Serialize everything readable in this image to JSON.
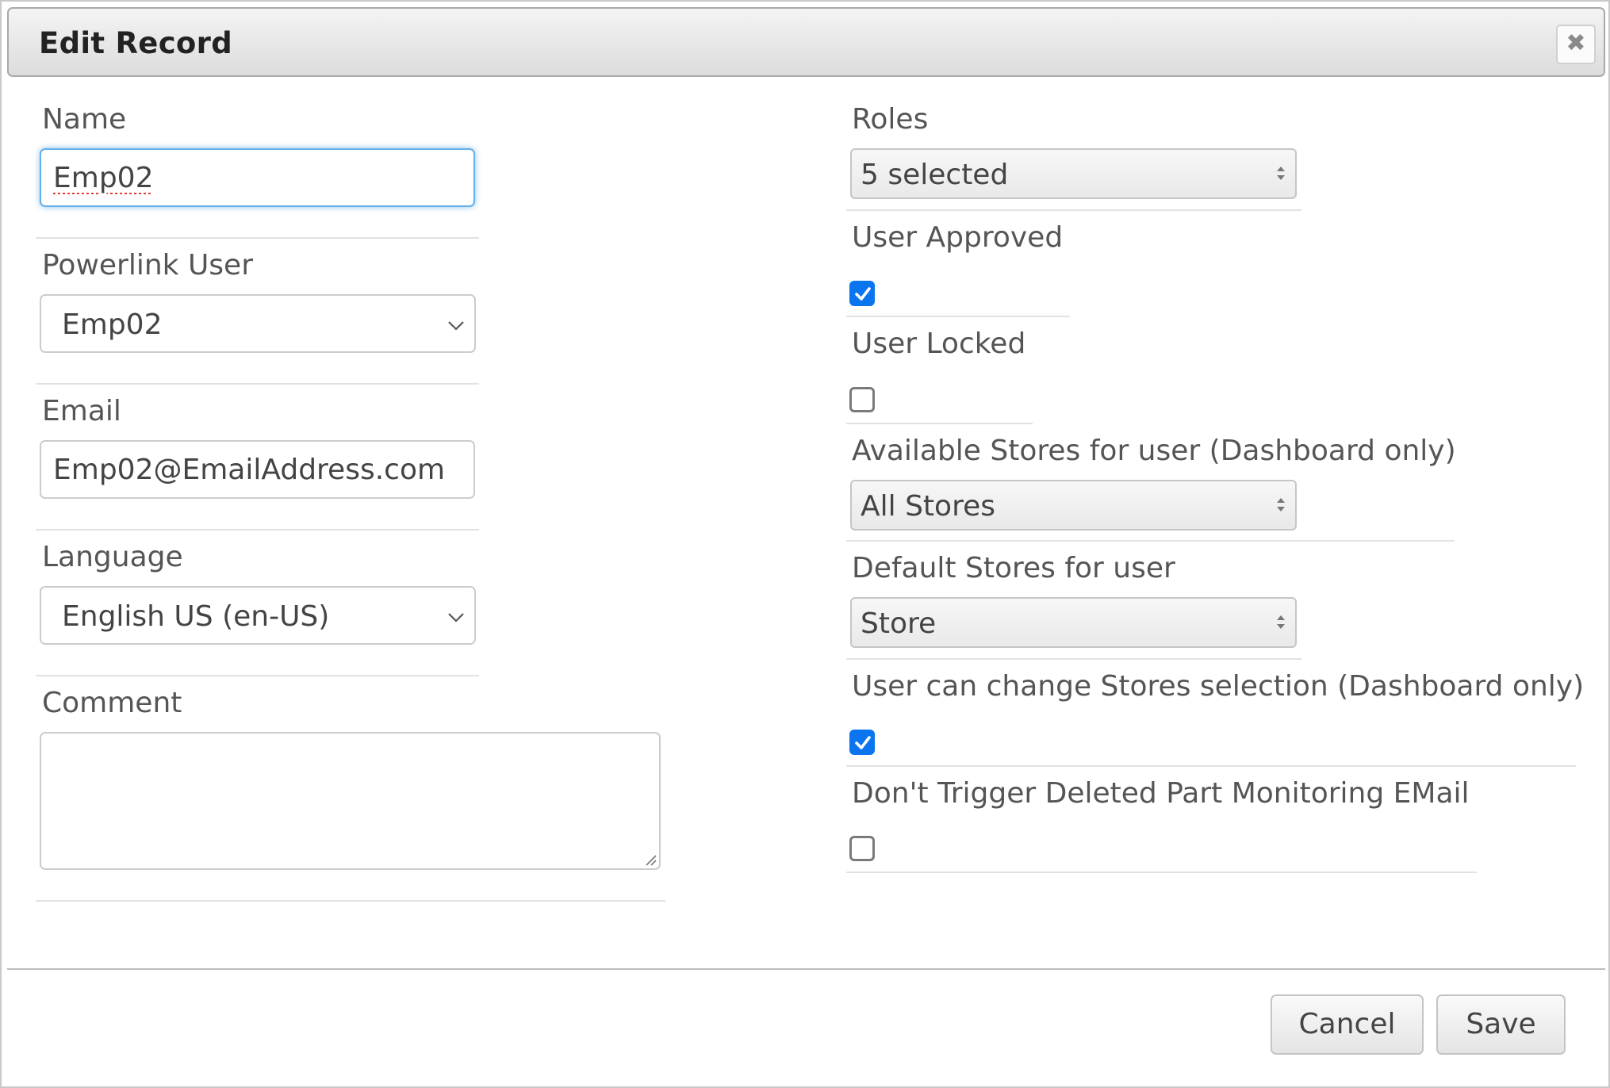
{
  "dialog": {
    "title": "Edit Record",
    "close_icon": "close-icon"
  },
  "left": {
    "name": {
      "label": "Name",
      "value": "Emp02"
    },
    "powerlink_user": {
      "label": "Powerlink User",
      "value": "Emp02"
    },
    "email": {
      "label": "Email",
      "value": "Emp02@EmailAddress.com"
    },
    "language": {
      "label": "Language",
      "value": "English US (en-US)"
    },
    "comment": {
      "label": "Comment",
      "value": ""
    }
  },
  "right": {
    "roles": {
      "label": "Roles",
      "value": "5 selected"
    },
    "user_approved": {
      "label": "User Approved",
      "checked": true
    },
    "user_locked": {
      "label": "User Locked",
      "checked": false
    },
    "available_stores": {
      "label": "Available Stores for user (Dashboard only)",
      "value": "All Stores"
    },
    "default_stores": {
      "label": "Default Stores for user",
      "value": "Store"
    },
    "user_can_change_stores": {
      "label": "User can change Stores selection (Dashboard only)",
      "checked": true
    },
    "dont_trigger_email": {
      "label": "Don't Trigger Deleted Part Monitoring EMail",
      "checked": false
    }
  },
  "footer": {
    "cancel_label": "Cancel",
    "save_label": "Save"
  },
  "colors": {
    "checkbox_checked": "#0b75f0",
    "focus_ring": "#66afe9"
  }
}
